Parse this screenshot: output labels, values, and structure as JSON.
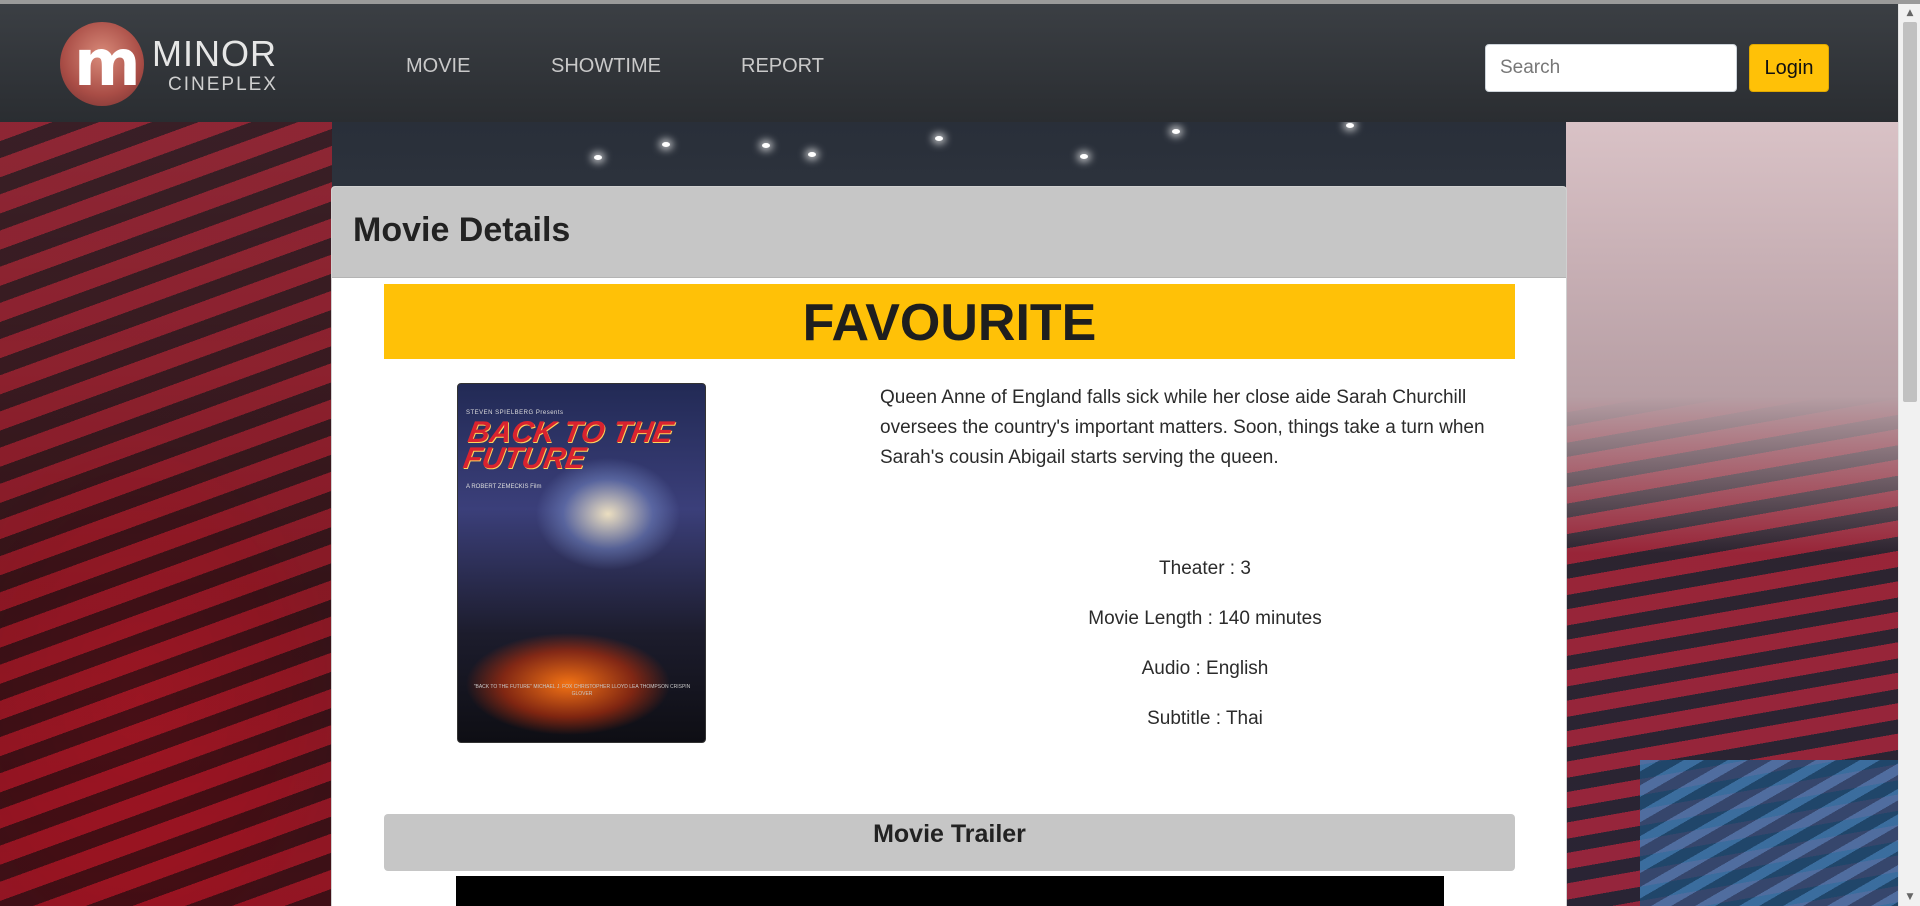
{
  "navbar": {
    "logo": {
      "name": "MINOR",
      "sub": "CINEPLEX",
      "letter": "m"
    },
    "links": [
      {
        "label": "MOVIE"
      },
      {
        "label": "SHOWTIME"
      },
      {
        "label": "REPORT"
      }
    ],
    "search": {
      "placeholder": "Search",
      "value": ""
    },
    "login_label": "Login",
    "accent_color": "#ffc107"
  },
  "card": {
    "header_title": "Movie Details",
    "movie_title": "FAVOURITE",
    "poster": {
      "studio": "STEVEN SPIELBERG Presents",
      "title": "BACK TO THE FUTURE",
      "director": "A ROBERT ZEMECKIS Film",
      "credits": "\"BACK TO THE FUTURE\" MICHAEL J. FOX CHRISTOPHER LLOYD LEA THOMPSON CRISPIN GLOVER"
    },
    "description": "Queen Anne of England falls sick while her close aide Sarah Churchill oversees the country's important matters. Soon, things take a turn when Sarah's cousin Abigail starts serving the queen.",
    "details": {
      "theater": "Theater : 3",
      "length": "Movie Length : 140 minutes",
      "audio": "Audio : English",
      "subtitle": "Subtitle : Thai"
    },
    "trailer_title": "Movie Trailer"
  },
  "scrollbar": {
    "up_icon": "triangle-up",
    "down_icon": "triangle-down"
  }
}
